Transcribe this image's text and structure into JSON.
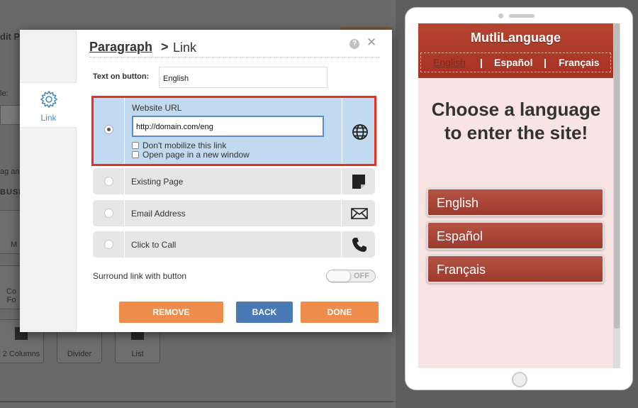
{
  "background": {
    "title_fragment": "dit P",
    "field_label": "le:",
    "text_fragment": "ag an",
    "section_fragment": "BUSI",
    "tile_fragments": [
      "M",
      "Co\nFo"
    ],
    "tiles": [
      "2 Columns",
      "Divider",
      "List"
    ]
  },
  "dialog": {
    "sidebar": {
      "tab_label": "Link"
    },
    "breadcrumb": {
      "parent": "Paragraph",
      "separator": ">",
      "current": "Link"
    },
    "help_label": "?",
    "close_label": "✕",
    "text_on_button": {
      "label": "Text on button:",
      "value": "English"
    },
    "website": {
      "title": "Website URL",
      "url": "http://domain.com/eng",
      "dont_mobilize": "Don't mobilize this link",
      "new_window": "Open page in a new window",
      "selected": true
    },
    "options": [
      {
        "label": "Existing Page",
        "icon": "page-icon"
      },
      {
        "label": "Email Address",
        "icon": "envelope-icon"
      },
      {
        "label": "Click to Call",
        "icon": "phone-icon"
      }
    ],
    "surround": {
      "label": "Surround link with button",
      "toggle": "OFF"
    },
    "buttons": {
      "remove": "REMOVE",
      "back": "BACK",
      "done": "DONE"
    }
  },
  "preview": {
    "site_title": "MutliLanguage",
    "nav": [
      "English",
      "Español",
      "Français"
    ],
    "nav_separator": "|",
    "heading": "Choose a language to enter the site!",
    "buttons": [
      "English",
      "Español",
      "Français"
    ]
  },
  "colors": {
    "accent_orange": "#ee8c4b",
    "accent_blue": "#4a7ab5",
    "highlight_red": "#e8301e",
    "site_red": "#a63224"
  }
}
